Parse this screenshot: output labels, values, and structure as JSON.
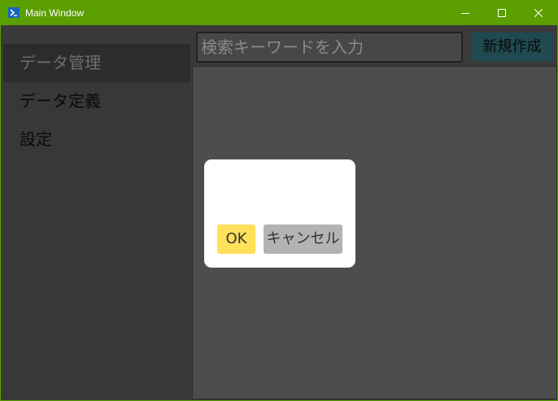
{
  "window": {
    "title": "Main Window",
    "app_icon": "powershell-icon",
    "controls": [
      "minimize-icon",
      "maximize-icon",
      "close-icon"
    ],
    "accent_color": "#5a9e00"
  },
  "sidebar": {
    "items": [
      {
        "label": "データ管理",
        "active": true
      },
      {
        "label": "データ定義",
        "active": false
      },
      {
        "label": "設定",
        "active": false
      }
    ]
  },
  "toolbar": {
    "search_placeholder": "検索キーワードを入力",
    "new_button_label": "新規作成"
  },
  "dialog": {
    "ok_label": "OK",
    "cancel_label": "キャンセル",
    "ok_color": "#ffe05a",
    "cancel_color": "#b3b3b3"
  }
}
